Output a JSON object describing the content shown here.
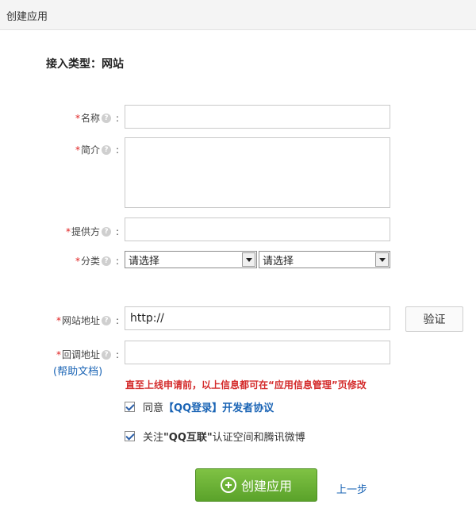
{
  "header": {
    "title": "创建应用"
  },
  "section": {
    "title": "接入类型：网站"
  },
  "form": {
    "name_label": "名称",
    "intro_label": "简介",
    "provider_label": "提供方",
    "category_label": "分类",
    "category_select_1": "请选择",
    "category_select_2": "请选择",
    "site_label": "网站地址",
    "site_value": "http://",
    "verify_label": "验证",
    "callback_label": "回调地址",
    "help_doc": "(帮助文档)",
    "required_mark": "*",
    "help_mark": "?",
    "colon": ":"
  },
  "notice": "直至上线申请前，以上信息都可在“应用信息管理”页修改",
  "agree": {
    "prefix": "同意",
    "link": "【QQ登录】开发者协议"
  },
  "follow": {
    "text1": "关注",
    "text2": "\"QQ互联\"",
    "text3": "认证空间和腾讯微博"
  },
  "actions": {
    "create_label": "创建应用",
    "prev_label": "上一步"
  },
  "colors": {
    "accent_green": "#5aa22a",
    "link_blue": "#1a64b5",
    "required_red": "#e02020"
  }
}
